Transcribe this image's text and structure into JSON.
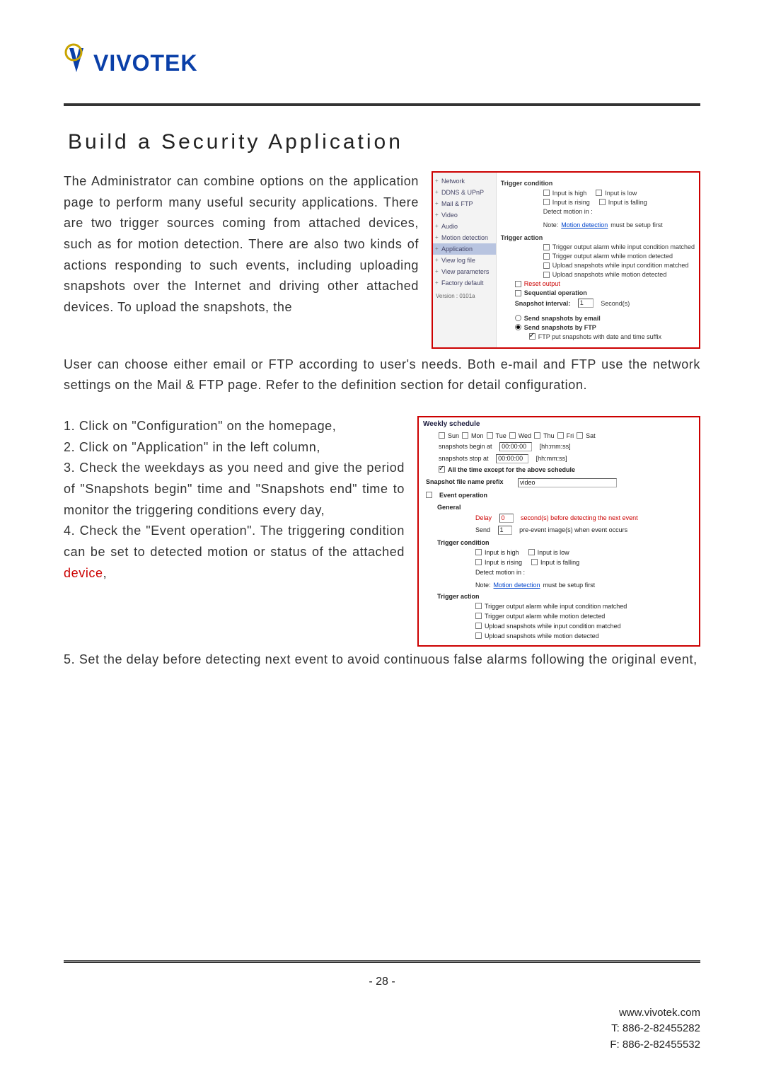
{
  "brand": "VIVOTEK",
  "title": "Build a Security Application",
  "para_intro": "The Administrator can combine options on the application page to perform many useful security applications. There are two trigger sources coming from attached devices, such as for motion detection. There are also two kinds of actions responding to such events, including uploading snapshots over the Internet and driving other attached devices. To upload the snapshots, the",
  "para_after": "User can choose either email or FTP according to user's needs. Both e-mail and FTP use the network settings on the Mail & FTP page. Refer to the definition section for detail configuration.",
  "steps": {
    "s1": "1. Click on \"Configuration\" on the homepage,",
    "s2": "2. Click on \"Application\" in the left column,",
    "s3": "3. Check the weekdays as you need and give the period of \"Snapshots begin\" time and \"Snapshots end\" time to monitor the triggering conditions every day,",
    "s4_a": "4. Check the \"Event operation\". The triggering condition can be set to detected motion or status of the attached ",
    "s4_b": "device",
    "s4_c": ",",
    "s5": "5. Set the delay before detecting next event to avoid continuous false alarms following the original event,"
  },
  "shot1": {
    "sidebar": [
      "Network",
      "DDNS & UPnP",
      "Mail & FTP",
      "Video",
      "Audio",
      "Motion detection",
      "Application",
      "View log file",
      "View parameters",
      "Factory default"
    ],
    "version": "Version : 0101a",
    "trig_cond": "Trigger condition",
    "in_high": "Input is high",
    "in_low": "Input is low",
    "in_rise": "Input is rising",
    "in_fall": "Input is falling",
    "det_in": "Detect motion in :",
    "note_pre": "Note: ",
    "note_link": "Motion detection",
    "note_post": " must be setup first",
    "trig_act": "Trigger action",
    "ta1": "Trigger output alarm while input condition matched",
    "ta2": "Trigger output alarm while motion detected",
    "ta3": "Upload snapshots while input condition matched",
    "ta4": "Upload snapshots while motion detected",
    "reset": "Reset output",
    "seq": "Sequential operation",
    "snap_int": "Snapshot interval:",
    "snap_val": "1",
    "snap_unit": "Second(s)",
    "send_email": "Send snapshots by email",
    "send_ftp": "Send snapshots by FTP",
    "ftp_suffix": "FTP put snapshots with date and time suffix"
  },
  "shot2": {
    "weekly": "Weekly schedule",
    "days": {
      "sun": "Sun",
      "mon": "Mon",
      "tue": "Tue",
      "wed": "Wed",
      "thu": "Thu",
      "fri": "Fri",
      "sat": "Sat"
    },
    "begin_label": "snapshots begin at",
    "begin_val": "00:00:00",
    "stop_label": "snapshots stop at",
    "stop_val": "00:00:00",
    "hhmmss": "[hh:mm:ss]",
    "all_time": "All the time except for the above schedule",
    "prefix_label": "Snapshot file name prefix",
    "prefix_val": "video",
    "event_op": "Event operation",
    "general": "General",
    "delay_label": "Delay",
    "delay_val": "0",
    "delay_rest": "second(s) before detecting the next event",
    "send_label": "Send",
    "send_val": "1",
    "send_rest": "pre-event image(s) when event occurs",
    "trig_cond": "Trigger condition",
    "in_high": "Input is high",
    "in_low": "Input is low",
    "in_rise": "Input is rising",
    "in_fall": "Input is falling",
    "det_in": "Detect motion in :",
    "note_pre": "Note: ",
    "note_link": "Motion detection",
    "note_post": " must be setup first",
    "trig_act": "Trigger action",
    "ta1": "Trigger output alarm while input condition matched",
    "ta2": "Trigger output alarm while motion detected",
    "ta3": "Upload snapshots while input condition matched",
    "ta4": "Upload snapshots while motion detected"
  },
  "footer": {
    "page": "- 28 -",
    "url": "www.vivotek.com",
    "tel": "T: 886-2-82455282",
    "fax": "F: 886-2-82455532"
  }
}
